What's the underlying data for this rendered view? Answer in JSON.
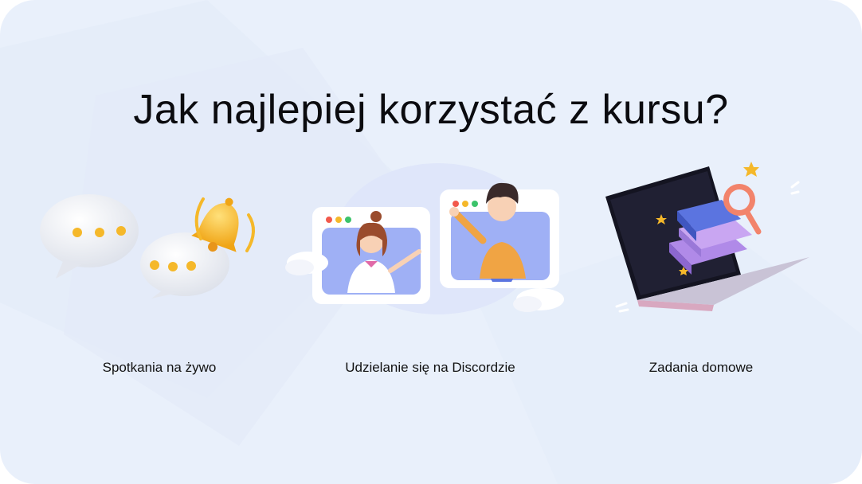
{
  "page": {
    "title": "Jak najlepiej korzystać z kursu?",
    "background_color": "#e9f0fb"
  },
  "features": [
    {
      "label": "Spotkania na żywo",
      "icon": "chat-bubbles-bell-icon"
    },
    {
      "label": "Udzielanie się na Discordzie",
      "icon": "video-call-people-icon"
    },
    {
      "label": "Zadania domowe",
      "icon": "laptop-books-icon"
    }
  ],
  "colors": {
    "title": "#0b0b0f",
    "accent_yellow": "#f5b82a",
    "accent_blue": "#5b74e0",
    "accent_purple": "#b08ae8",
    "accent_orange": "#f0a444"
  }
}
